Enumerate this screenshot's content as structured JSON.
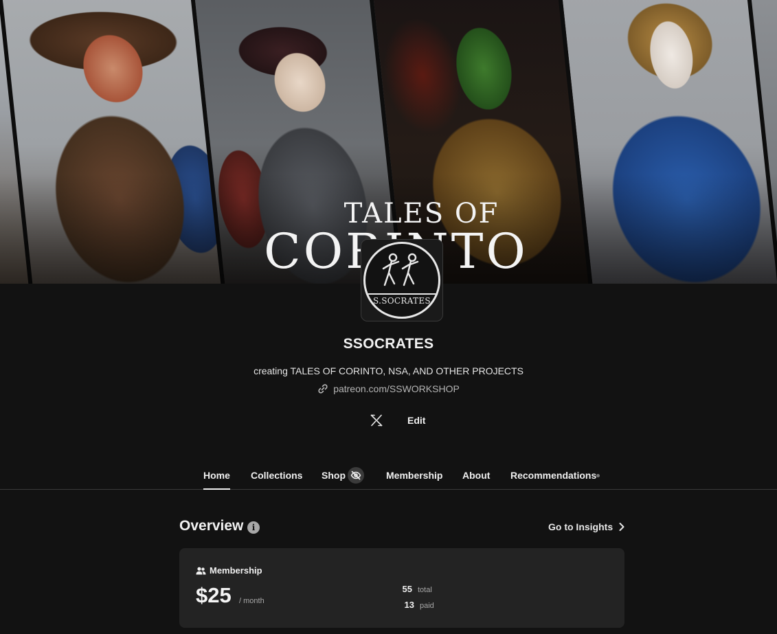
{
  "banner": {
    "title_top": "TALES OF",
    "title_main": "CORINTO"
  },
  "avatar": {
    "badge_text": "S.SOCRATES"
  },
  "profile": {
    "name": "SSOCRATES",
    "tagline": "creating TALES OF CORINTO, NSA, AND OTHER PROJECTS",
    "link": "patreon.com/SSWORKSHOP",
    "edit_label": "Edit"
  },
  "tabs": [
    {
      "label": "Home",
      "active": true
    },
    {
      "label": "Collections",
      "active": false
    },
    {
      "label": "Shop",
      "active": false
    },
    {
      "label": "Membership",
      "active": false
    },
    {
      "label": "About",
      "active": false
    },
    {
      "label": "Recommendations",
      "active": false
    }
  ],
  "overview": {
    "title": "Overview",
    "insights_label": "Go to Insights",
    "membership": {
      "heading": "Membership",
      "price": "$25",
      "period": "/ month",
      "total_value": "55",
      "total_label": "total",
      "paid_value": "13",
      "paid_label": "paid"
    }
  },
  "icons": {
    "link": "link-icon",
    "social": "x-logo-icon",
    "shop_badge": "eye-off-icon",
    "info": "info-icon",
    "chevron": "chevron-right-icon",
    "members": "people-icon"
  }
}
